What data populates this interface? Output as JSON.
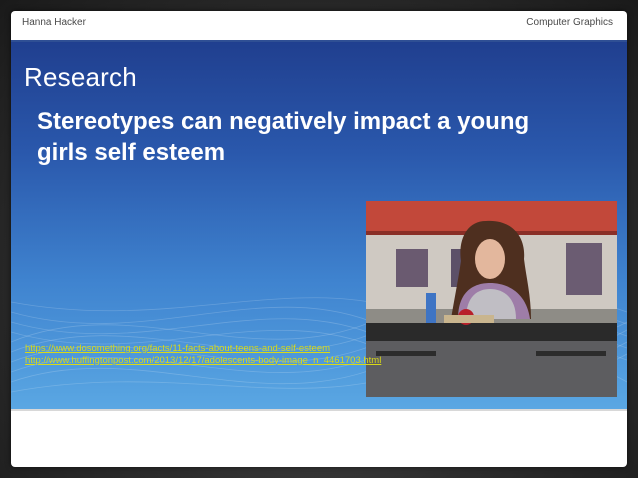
{
  "header": {
    "author": "Hanna Hacker",
    "course": "Computer Graphics"
  },
  "slide": {
    "title": "Research",
    "subtitle": "Stereotypes can negatively impact a young girls self esteem",
    "links": [
      "https://www.dosomething.org/facts/11-facts-about-teens-and-self-esteem",
      "http://www.huffingtonpost.com/2013/12/17/adolescents-body-image_n_4461703.html"
    ]
  },
  "photo": {
    "subject": "girl-sitting-at-cafeteria-table-with-food-tray"
  },
  "colors": {
    "panel_top": "#203f8f",
    "panel_bottom": "#5aa7e3",
    "link": "#d9d916",
    "header_line": "#2f4f94"
  }
}
